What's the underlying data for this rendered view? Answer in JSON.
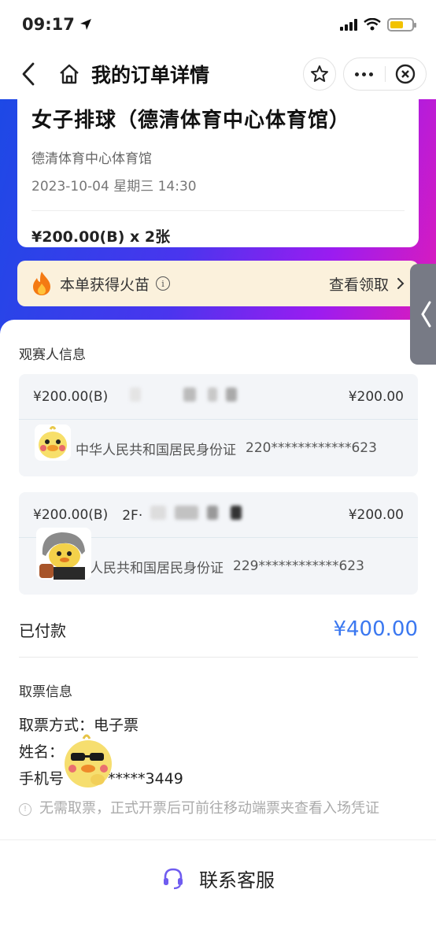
{
  "status": {
    "time": "09:17"
  },
  "nav": {
    "title": "我的订单详情"
  },
  "event": {
    "title": "女子排球（德清体育中心体育馆）",
    "venue": "德清体育中心体育馆",
    "datetime": "2023-10-04 星期三 14:30",
    "price_qty": "¥200.00(B) x 2张"
  },
  "fire": {
    "label": "本单获得火苗",
    "info_icon": "i",
    "link": "查看领取"
  },
  "spectators": {
    "section_label": "观赛人信息",
    "tickets": [
      {
        "tier": "¥200.00(B)",
        "seat": "",
        "amount": "¥200.00",
        "id_type": "中华人民共和国居民身份证",
        "id_number": "220************623"
      },
      {
        "tier": "¥200.00(B)",
        "seat": "2F·",
        "amount": "¥200.00",
        "id_type": "人民共和国居民身份证",
        "id_number": "229************623"
      }
    ]
  },
  "payment": {
    "label": "已付款",
    "amount": "¥400.00"
  },
  "pickup": {
    "section_label": "取票信息",
    "method": "取票方式：电子票",
    "name": "姓名：",
    "phone_prefix": "手机号",
    "phone_suffix": "*****3449",
    "notice": "无需取票，正式开票后可前往移动端票夹查看入场凭证"
  },
  "footer": {
    "contact": "联系客服"
  },
  "colors": {
    "accent_blue": "#3b78f0",
    "gradient_start": "#1d49e6",
    "gradient_end": "#e01bb8",
    "fire_bg": "#fbf1dc"
  }
}
